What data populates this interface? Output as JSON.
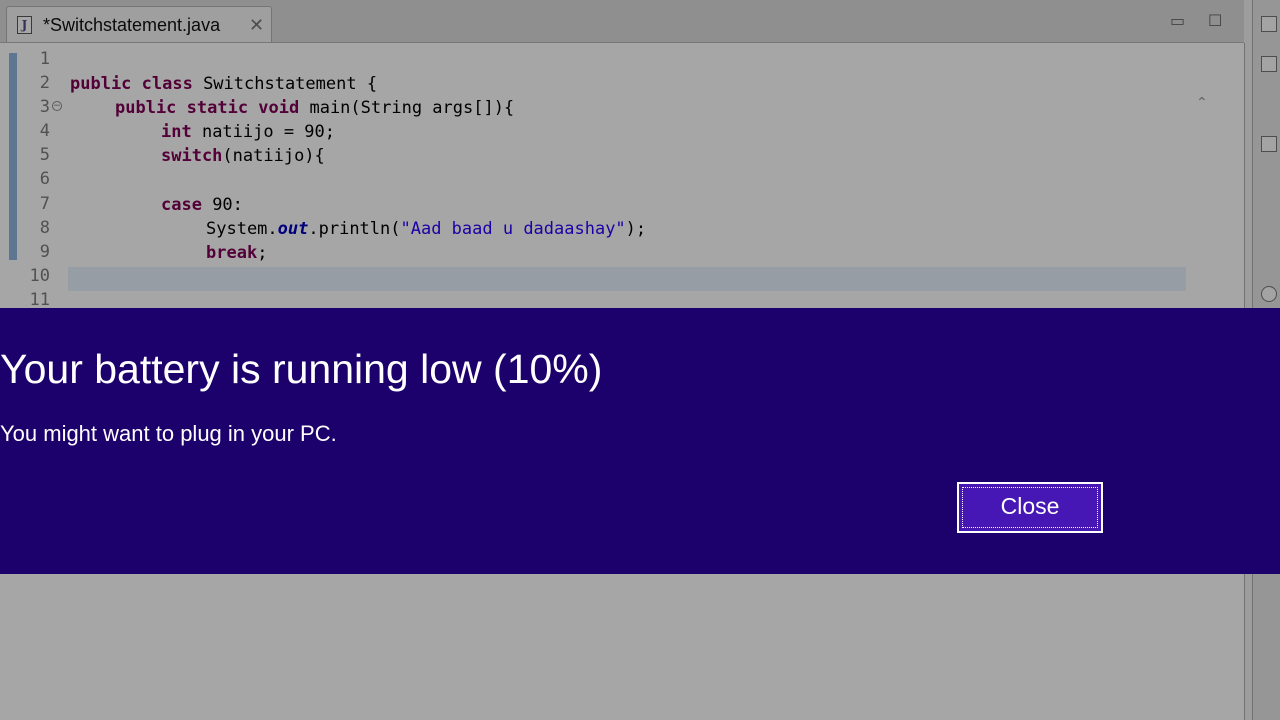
{
  "editor": {
    "tab_title": "*Switchstatement.java",
    "tab_icon": "java-file-icon",
    "line_numbers": [
      "1",
      "2",
      "3",
      "4",
      "5",
      "6",
      "7",
      "8",
      "9",
      "10",
      "11"
    ],
    "code": {
      "l2_kw": "public class",
      "l2_rest": " Switchstatement {",
      "l3_kw": "public static void",
      "l3_rest": " main(String args[]){",
      "l4_kw": "int",
      "l4_rest": " natiijo = 90;",
      "l5_kw": "switch",
      "l5_rest": "(natiijo){",
      "l7_kw": "case",
      "l7_rest": " 90:",
      "l8_pre": "System.",
      "l8_field": "out",
      "l8_mid": ".println(",
      "l8_str": "\"Aad baad u dadaashay\"",
      "l8_end": ");",
      "l9_kw": "break",
      "l9_rest": ";"
    }
  },
  "toast": {
    "title": "Your battery is running low (10%)",
    "message": "You might want to plug in your PC.",
    "close_label": "Close",
    "background": "#1c006b",
    "button_color": "#4617b4"
  },
  "battery_level_percent": 10
}
